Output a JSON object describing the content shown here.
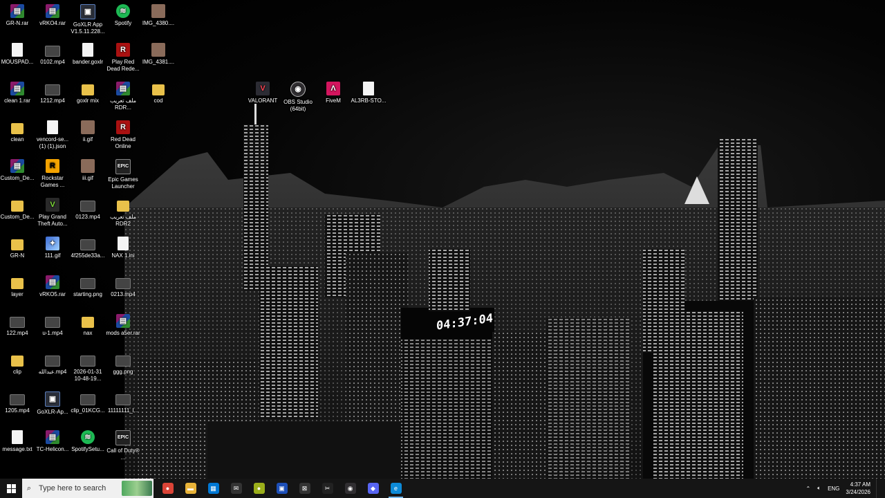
{
  "desktop": {
    "building_clock": "04:37:04",
    "icons": [
      {
        "label": "GR-N.rar",
        "type": "rar",
        "col": 0,
        "row": 0
      },
      {
        "label": "vRKO4.rar",
        "type": "rar",
        "col": 1,
        "row": 0
      },
      {
        "label": "GoXLR App V1.5.11.228...",
        "type": "app",
        "col": 2,
        "row": 0
      },
      {
        "label": "Spotify",
        "type": "spotify",
        "col": 3,
        "row": 0
      },
      {
        "label": "IMG_4380....",
        "type": "img-thumb",
        "col": 4,
        "row": 0
      },
      {
        "label": "MOUSPAD...",
        "type": "doc",
        "col": 0,
        "row": 1
      },
      {
        "label": "0102.mp4",
        "type": "vid",
        "col": 1,
        "row": 1
      },
      {
        "label": "bander.goxlr",
        "type": "doc",
        "col": 2,
        "row": 1
      },
      {
        "label": "Play Red Dead Rede...",
        "type": "red",
        "col": 3,
        "row": 1
      },
      {
        "label": "IMG_4381....",
        "type": "img-thumb",
        "col": 4,
        "row": 1
      },
      {
        "label": "clean 1.rar",
        "type": "rar",
        "col": 0,
        "row": 2
      },
      {
        "label": "1212.mp4",
        "type": "vid",
        "col": 1,
        "row": 2
      },
      {
        "label": "goxlr mix",
        "type": "folder",
        "col": 2,
        "row": 2
      },
      {
        "label": "ملف تعريب RDR...",
        "type": "rar",
        "col": 3,
        "row": 2
      },
      {
        "label": "cod",
        "type": "folder",
        "col": 4,
        "row": 2
      },
      {
        "label": "clean",
        "type": "folder",
        "col": 0,
        "row": 3
      },
      {
        "label": "vencord-se... (1) (1).json",
        "type": "doc",
        "col": 1,
        "row": 3
      },
      {
        "label": "ii.gif",
        "type": "img-thumb",
        "col": 2,
        "row": 3
      },
      {
        "label": "Red Dead Online",
        "type": "red",
        "col": 3,
        "row": 3
      },
      {
        "label": "Custom_De...",
        "type": "rar",
        "col": 0,
        "row": 4
      },
      {
        "label": "Rockstar Games ...",
        "type": "rs",
        "col": 1,
        "row": 4
      },
      {
        "label": "iii.gif",
        "type": "img-thumb",
        "col": 2,
        "row": 4
      },
      {
        "label": "Epic Games Launcher",
        "type": "epic",
        "col": 3,
        "row": 4
      },
      {
        "label": "Custom_De...",
        "type": "folder",
        "col": 0,
        "row": 5
      },
      {
        "label": "Play Grand Theft Auto...",
        "type": "gta",
        "col": 1,
        "row": 5
      },
      {
        "label": "0123.mp4",
        "type": "vid",
        "col": 2,
        "row": 5
      },
      {
        "label": "ملف تعريب RDR2",
        "type": "folder",
        "col": 3,
        "row": 5
      },
      {
        "label": "GR-N",
        "type": "folder",
        "col": 0,
        "row": 6
      },
      {
        "label": "111.gif",
        "type": "gif",
        "col": 1,
        "row": 6
      },
      {
        "label": "4f255de33a...",
        "type": "vid",
        "col": 2,
        "row": 6
      },
      {
        "label": "NAX 1.ini",
        "type": "doc",
        "col": 3,
        "row": 6
      },
      {
        "label": "layer",
        "type": "folder",
        "col": 0,
        "row": 7
      },
      {
        "label": "vRKO5.rar",
        "type": "rar",
        "col": 1,
        "row": 7
      },
      {
        "label": "starting.png",
        "type": "vid",
        "col": 2,
        "row": 7
      },
      {
        "label": "0213.mp4",
        "type": "vid",
        "col": 3,
        "row": 7
      },
      {
        "label": "122.mp4",
        "type": "vid",
        "col": 0,
        "row": 8
      },
      {
        "label": "u-1.mp4",
        "type": "vid",
        "col": 1,
        "row": 8
      },
      {
        "label": "nax",
        "type": "folder",
        "col": 2,
        "row": 8
      },
      {
        "label": "mods a5er.rar",
        "type": "rar",
        "col": 3,
        "row": 8
      },
      {
        "label": "clip",
        "type": "folder",
        "col": 0,
        "row": 9
      },
      {
        "label": "عبدالله.mp4",
        "type": "vid",
        "col": 1,
        "row": 9
      },
      {
        "label": "2026-01-31 10-48-19...",
        "type": "vid",
        "col": 2,
        "row": 9
      },
      {
        "label": "ggg.png",
        "type": "vid",
        "col": 3,
        "row": 9
      },
      {
        "label": "1205.mp4",
        "type": "vid",
        "col": 0,
        "row": 10
      },
      {
        "label": "GoXLR-Ap...",
        "type": "app",
        "col": 1,
        "row": 10
      },
      {
        "label": "clip_01KCG...",
        "type": "vid",
        "col": 2,
        "row": 10
      },
      {
        "label": "11111111_l...",
        "type": "vid",
        "col": 3,
        "row": 10
      },
      {
        "label": "message.txt",
        "type": "doc",
        "col": 0,
        "row": 11
      },
      {
        "label": "TC-Helicon...",
        "type": "rar",
        "col": 1,
        "row": 11
      },
      {
        "label": "SpotifySetu...",
        "type": "spotify",
        "col": 2,
        "row": 11
      },
      {
        "label": "Call of Duty® ...",
        "type": "epic",
        "col": 3,
        "row": 11
      }
    ],
    "floating_icons": [
      {
        "label": "VALORANT",
        "type": "val",
        "glyph": "V"
      },
      {
        "label": "OBS Studio (64bit)",
        "type": "obs",
        "glyph": "◉"
      },
      {
        "label": "FiveM",
        "type": "fivem",
        "glyph": "Λ"
      },
      {
        "label": "AL3RB-STO...",
        "type": "doc",
        "glyph": ""
      }
    ]
  },
  "taskbar": {
    "search_placeholder": "Type here to search",
    "apps": [
      {
        "name": "chrome",
        "color": "#db4437",
        "glyph": "●"
      },
      {
        "name": "file-explorer",
        "color": "#e8b339",
        "glyph": "▬"
      },
      {
        "name": "microsoft-store",
        "color": "#0078d4",
        "glyph": "▦"
      },
      {
        "name": "mail",
        "color": "#333",
        "glyph": "✉"
      },
      {
        "name": "app-green",
        "color": "#9aae1a",
        "glyph": "●"
      },
      {
        "name": "app-blue",
        "color": "#1d4fb8",
        "glyph": "▣"
      },
      {
        "name": "xbox",
        "color": "#333",
        "glyph": "⊠"
      },
      {
        "name": "capcut",
        "color": "#222",
        "glyph": "✂"
      },
      {
        "name": "obs",
        "color": "#302e31",
        "glyph": "◉"
      },
      {
        "name": "discord",
        "color": "#5865f2",
        "glyph": "◆"
      },
      {
        "name": "edge",
        "color": "#0c8ad8",
        "glyph": "e"
      }
    ],
    "language": "ENG",
    "time": "4:37 AM",
    "date": "3/24/2026"
  }
}
